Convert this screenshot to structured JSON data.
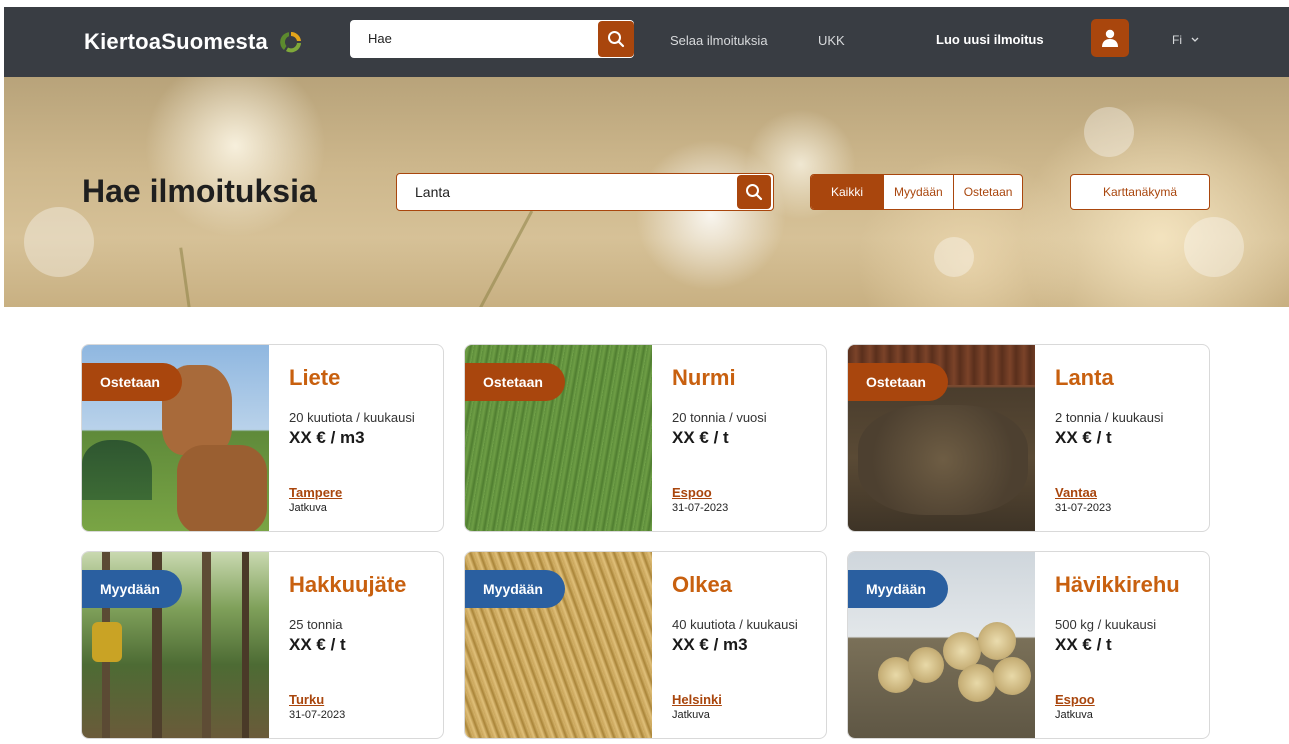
{
  "header": {
    "logo_text": "KiertoaSuomesta",
    "search_value": "Hae",
    "nav_browse": "Selaa ilmoituksia",
    "nav_faq": "UKK",
    "nav_create": "Luo uusi ilmoitus",
    "language": "Fi"
  },
  "hero": {
    "title": "Hae ilmoituksia",
    "search_value": "Lanta",
    "filters": [
      "Kaikki",
      "Myydään",
      "Ostetaan"
    ],
    "active_filter": "Kaikki",
    "map_view": "Karttanäkymä"
  },
  "colors": {
    "brand": "#a9460d",
    "buy_badge": "#a9460d",
    "sell_badge": "#2a5fa0",
    "title": "#c8600f",
    "topbar": "#393d43"
  },
  "listings": [
    {
      "badge": "Ostetaan",
      "title": "Liete",
      "quantity": "20 kuutiota / kuukausi",
      "price": "XX € / m3",
      "location": "Tampere",
      "date": "Jatkuva",
      "image": "cow"
    },
    {
      "badge": "Ostetaan",
      "title": "Nurmi",
      "quantity": "20 tonnia / vuosi",
      "price": "XX € / t",
      "location": "Espoo",
      "date": "31-07-2023",
      "image": "grass"
    },
    {
      "badge": "Ostetaan",
      "title": "Lanta",
      "quantity": "2 tonnia / kuukausi",
      "price": "XX € / t",
      "location": "Vantaa",
      "date": "31-07-2023",
      "image": "manure"
    },
    {
      "badge": "Myydään",
      "title": "Hakkuujäte",
      "quantity": "25 tonnia",
      "price": "XX € / t",
      "location": "Turku",
      "date": "31-07-2023",
      "image": "forest"
    },
    {
      "badge": "Myydään",
      "title": "Olkea",
      "quantity": "40 kuutiota / kuukausi",
      "price": "XX € / m3",
      "location": "Helsinki",
      "date": "Jatkuva",
      "image": "straw"
    },
    {
      "badge": "Myydään",
      "title": "Hävikkirehu",
      "quantity": "500 kg / kuukausi",
      "price": "XX € / t",
      "location": "Espoo",
      "date": "Jatkuva",
      "image": "bales"
    }
  ]
}
